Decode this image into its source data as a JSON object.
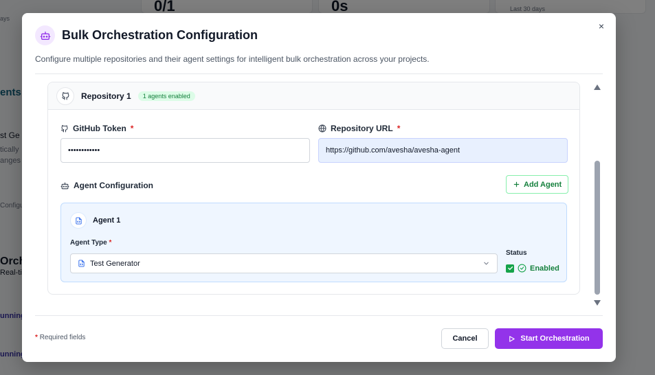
{
  "background": {
    "stat_one": "0/1",
    "stat_two": "0s",
    "last_days": "Last 30 days",
    "left_days": "ays",
    "agents_heading": "ents",
    "test_gen": "st Ge",
    "tically": "tically",
    "anges": "anges",
    "configu": "Configu",
    "orch": "Orch",
    "real_time": "Real-ti",
    "running_one": "unning",
    "running_two": "unning"
  },
  "modal": {
    "title": "Bulk Orchestration Configuration",
    "description": "Configure multiple repositories and their agent settings for intelligent bulk orchestration across your projects.",
    "close_glyph": "×"
  },
  "repository": {
    "name": "Repository 1",
    "badge": "1 agents enabled",
    "token_label": "GitHub Token",
    "token_required": "*",
    "token_value": "••••••••••••",
    "url_label": "Repository URL",
    "url_required": "*",
    "url_value": "https://github.com/avesha/avesha-agent"
  },
  "agent_config": {
    "label": "Agent Configuration",
    "add_button": "Add Agent",
    "agent_name": "Agent 1",
    "type_label": "Agent Type",
    "type_required": "*",
    "type_value": "Test Generator",
    "status_label": "Status",
    "status_value": "Enabled",
    "status_checked": true
  },
  "footer": {
    "required_star": "*",
    "required_note": "Required fields",
    "cancel": "Cancel",
    "start": "Start Orchestration"
  },
  "icons": {
    "title": "robot-icon",
    "repo": "github-icon",
    "token": "github-icon",
    "url": "globe-icon",
    "agent_config": "robot-icon",
    "add": "plus-icon",
    "agent": "file-code-icon",
    "select_item": "file-code-icon",
    "chevron": "chevron-down-icon",
    "check": "check-icon",
    "enabled": "check-circle-icon",
    "start": "play-icon"
  },
  "colors": {
    "accent": "#9333ea",
    "success": "#16a34a",
    "required": "#dc2626",
    "agent_card_bg": "#eff6ff"
  }
}
